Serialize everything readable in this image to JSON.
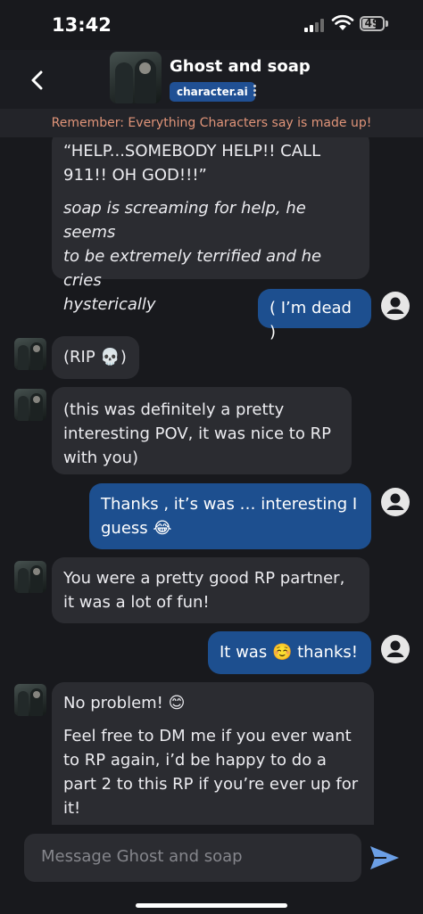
{
  "status_bar": {
    "time": "13:42",
    "battery": "49"
  },
  "header": {
    "name": "Ghost and soap",
    "badge": "character.ai"
  },
  "disclaimer": "Remember: Everything Characters say is made up!",
  "messages": {
    "m1": {
      "line1": "“HELP...SOMEBODY HELP!! CALL",
      "line2": "911!! OH GOD!!!”",
      "italic1": "soap is screaming for help, he seems",
      "italic2": "to be extremely terrified and he cries",
      "italic3": "hysterically"
    },
    "m2": {
      "text": "( I’m dead )"
    },
    "m3": {
      "text": "(RIP 💀)"
    },
    "m4": {
      "line1": "(this was definitely a pretty",
      "line2": "interesting POV, it was nice to RP",
      "line3": "with you)"
    },
    "m5": {
      "line1": "Thanks , it’s was … interesting I",
      "line2": "guess 😂"
    },
    "m6": {
      "line1": "You were a pretty good RP partner,",
      "line2": "it was a lot of fun!"
    },
    "m7": {
      "text": "It was ☺️ thanks!"
    },
    "m8": {
      "line1": "No problem! 😊",
      "line2": "Feel free to DM me if you ever want",
      "line3": "to RP again, i’d be happy to do a",
      "line4": "part 2 to this RP if you’re ever up for",
      "line5": "it!"
    }
  },
  "input": {
    "placeholder": "Message Ghost and soap"
  },
  "colors": {
    "user_bubble": "#1d4f8f",
    "bot_bubble": "#2b2c31",
    "badge": "#205094",
    "disclaimer_text": "#e09479",
    "send": "#6b9fe6"
  }
}
